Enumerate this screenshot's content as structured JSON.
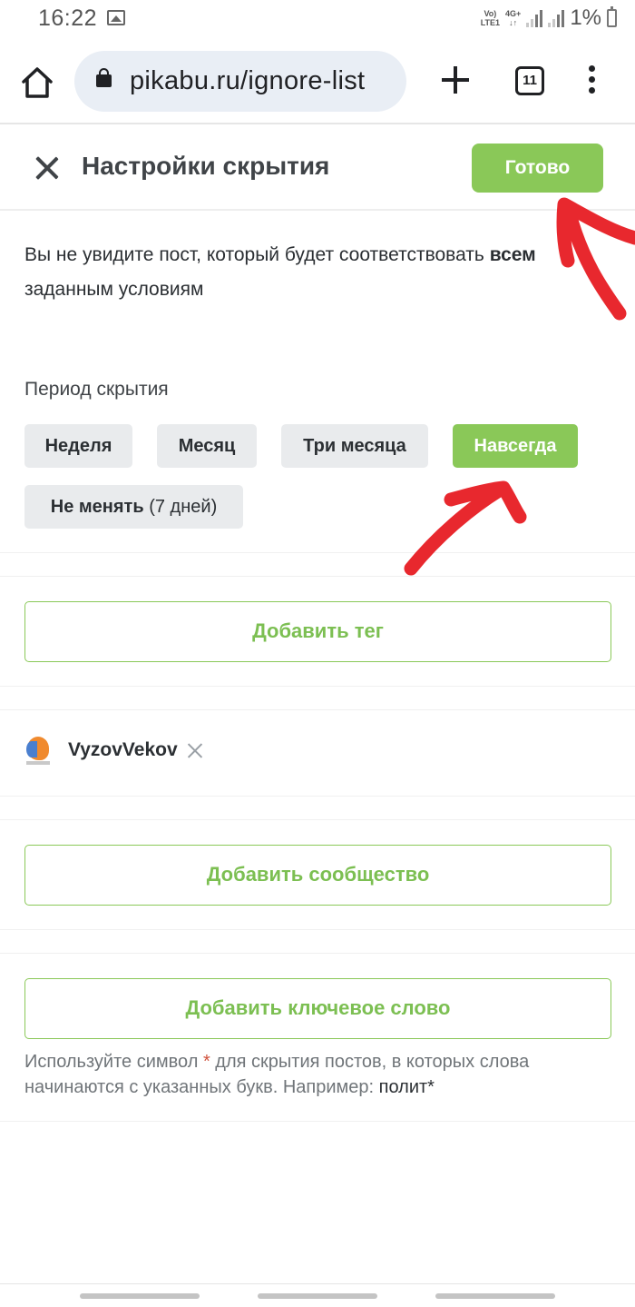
{
  "status_bar": {
    "time": "16:22",
    "network_top": "Vo)",
    "network_bottom": "LTE1",
    "network_type": "4G+",
    "battery": "1%"
  },
  "browser": {
    "url": "pikabu.ru/ignore-list",
    "tab_count": "11"
  },
  "dialog": {
    "title": "Настройки скрытия",
    "done_label": "Готово",
    "info_before": "Вы не увидите пост, который будет соответствовать ",
    "info_bold": "всем",
    "info_after": " заданным условиям"
  },
  "period": {
    "title": "Период скрытия",
    "options": [
      {
        "label": "Неделя",
        "active": false
      },
      {
        "label": "Месяц",
        "active": false
      },
      {
        "label": "Три месяца",
        "active": false
      },
      {
        "label": "Навсегда",
        "active": true
      }
    ],
    "keep_label": "Не менять",
    "keep_note": "(7 дней)"
  },
  "tags": {
    "add_label": "Добавить тег"
  },
  "users": {
    "items": [
      {
        "name": "VyzovVekov"
      }
    ]
  },
  "communities": {
    "add_label": "Добавить сообщество"
  },
  "keywords": {
    "add_label": "Добавить ключевое слово",
    "hint_before": "Используйте символ ",
    "hint_star": "*",
    "hint_middle": " для скрытия постов, в которых слова начинаются с указанных букв. Например: ",
    "hint_example": "полит*"
  },
  "colors": {
    "accent_green": "#8ac858",
    "annotation_red": "#e8282e"
  }
}
